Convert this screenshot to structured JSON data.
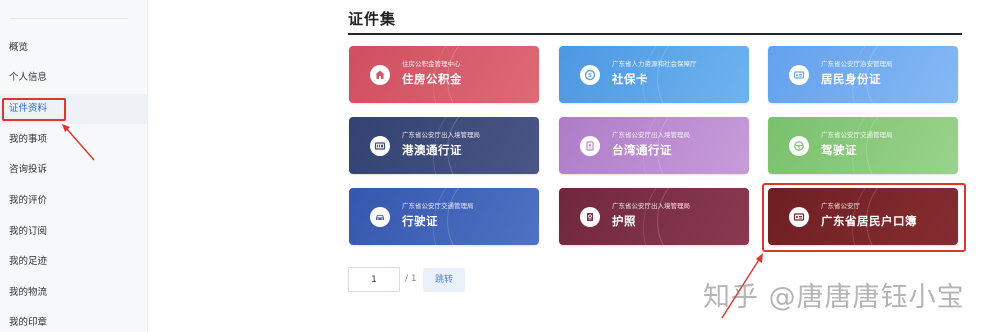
{
  "sidebar": {
    "items": [
      {
        "label": "概览"
      },
      {
        "label": "个人信息"
      },
      {
        "label": "证件资料"
      },
      {
        "label": "我的事项"
      },
      {
        "label": "咨询投诉"
      },
      {
        "label": "我的评价"
      },
      {
        "label": "我的订阅"
      },
      {
        "label": "我的足迹"
      },
      {
        "label": "我的物流"
      },
      {
        "label": "我的印章"
      }
    ],
    "active_item": "证件资料"
  },
  "main": {
    "title": "证件集",
    "cards": [
      {
        "issuer": "住房公积金管理中心",
        "name": "住房公积金",
        "icon": "house-icon",
        "color": "#d35665"
      },
      {
        "issuer": "广东省人力资源和社会保障厅",
        "name": "社保卡",
        "icon": "social-security-icon",
        "color": "#5aa3e6"
      },
      {
        "issuer": "广东省公安厅治安管理局",
        "name": "居民身份证",
        "icon": "id-card-icon",
        "color": "#6fa7ef"
      },
      {
        "issuer": "广东省公安厅出入境管理局",
        "name": "港澳通行证",
        "icon": "permit-icon",
        "color": "#3d4a7a"
      },
      {
        "issuer": "广东省公安厅出入境管理局",
        "name": "台湾通行证",
        "icon": "passport-book-icon",
        "color": "#b98bd0"
      },
      {
        "issuer": "广东省公安厅交通管理局",
        "name": "驾驶证",
        "icon": "steering-wheel-icon",
        "color": "#86c97a"
      },
      {
        "issuer": "广东省公安厅交通管理局",
        "name": "行驶证",
        "icon": "car-icon",
        "color": "#3f63b5"
      },
      {
        "issuer": "广东省公安厅出入境管理局",
        "name": "护照",
        "icon": "passport-icon",
        "color": "#7a2f44"
      },
      {
        "issuer": "广东省公安厅",
        "name": "广东省居民户口簿",
        "icon": "household-register-icon",
        "color": "#7b2528"
      }
    ]
  },
  "pagination": {
    "current": "1",
    "total": "/ 1",
    "jump_label": "跳转"
  },
  "watermark": "知乎 @唐唐唐钰小宝",
  "colors": {
    "accent": "#2c6fd6",
    "annotation_red": "#e0342f"
  }
}
